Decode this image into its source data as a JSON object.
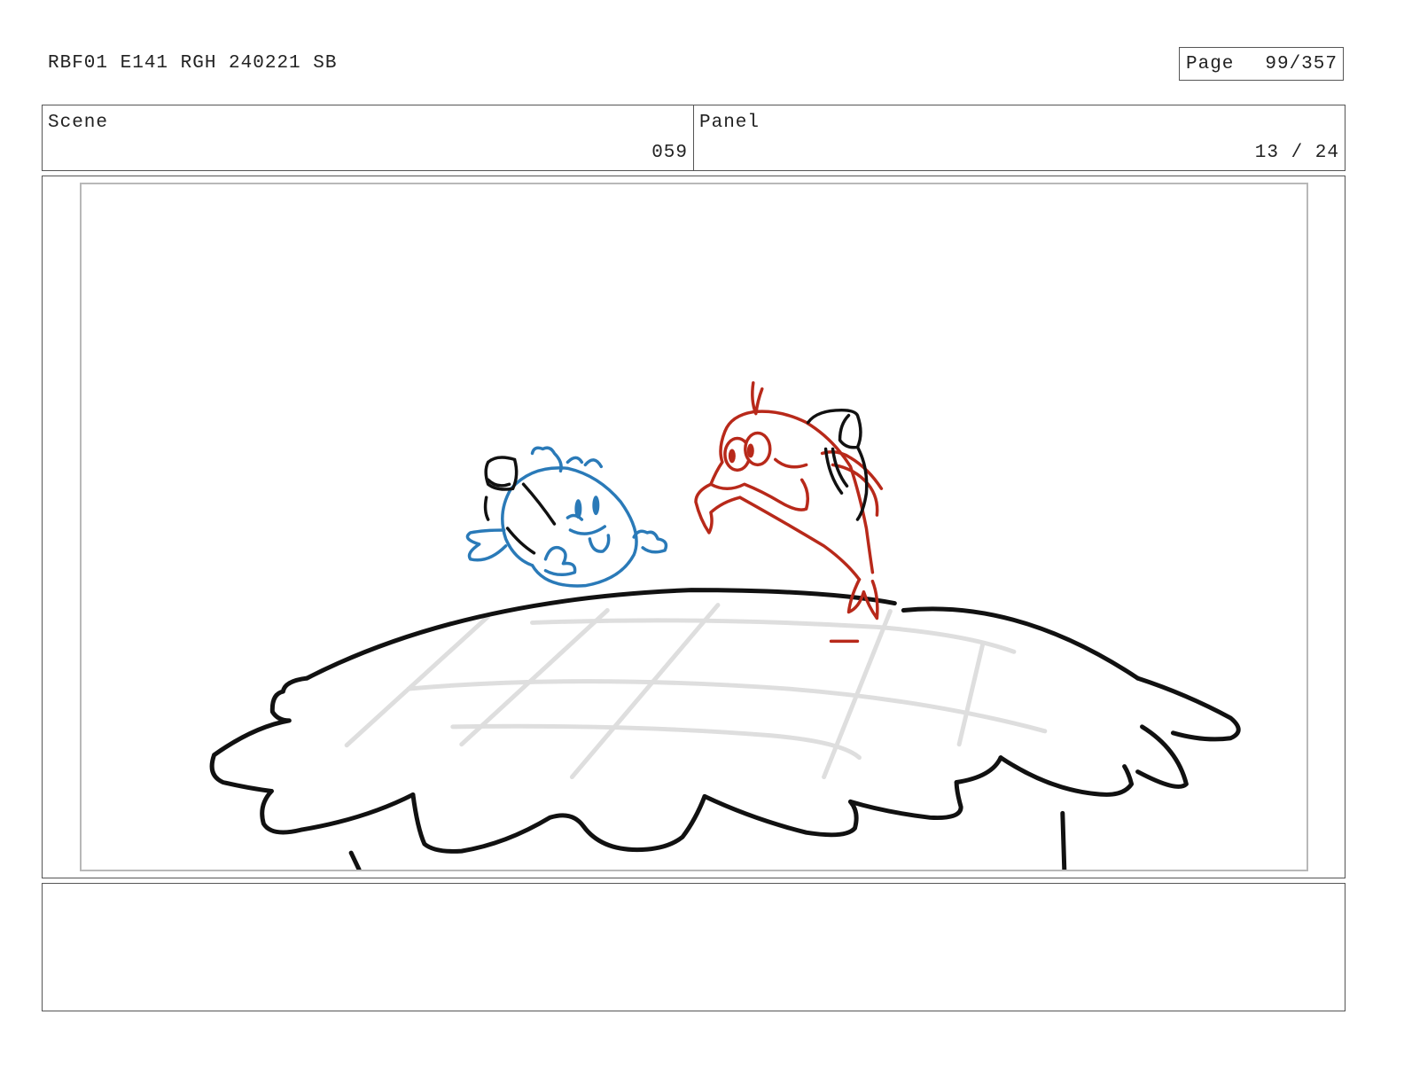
{
  "document": {
    "title": "RBF01 E141 RGH 240221 SB",
    "page_label": "Page",
    "page_value": "99/357"
  },
  "info": {
    "scene_label": "Scene",
    "scene_value": "059",
    "panel_label": "Panel",
    "panel_value": "13 / 24"
  },
  "panel": {
    "content": [
      "blue-fish-sketch",
      "red-fish-sketch",
      "pie-crust-sketch"
    ],
    "colors": {
      "blue_fish": "#2a7ab8",
      "red_fish": "#b8291a",
      "ink": "#111111",
      "lattice": "#dedede"
    }
  },
  "notes": {
    "text": ""
  }
}
